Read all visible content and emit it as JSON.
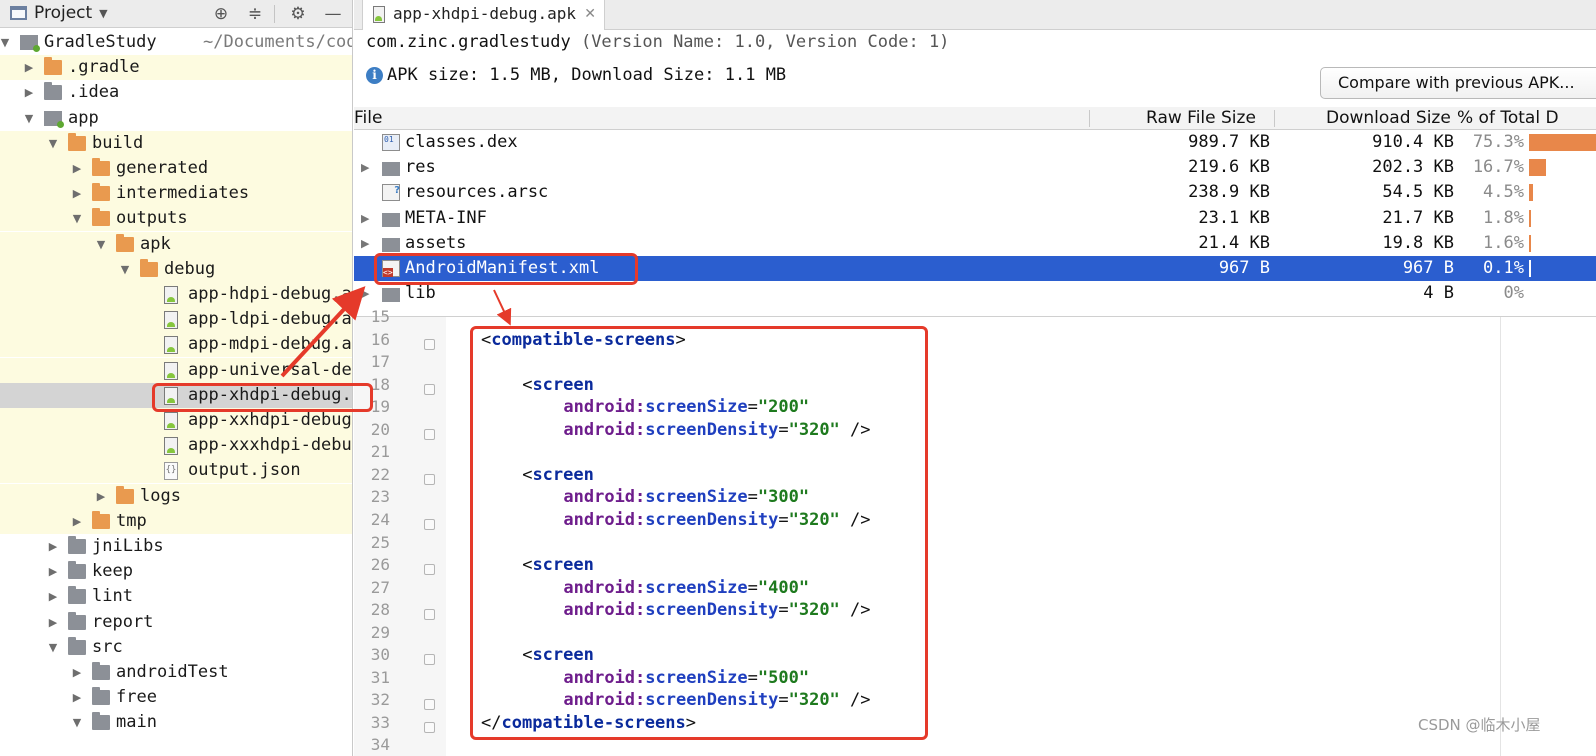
{
  "project_panel": {
    "title": "Project",
    "tree": [
      {
        "label": "GradleStudy",
        "sub": "~/Documents/code",
        "icon": "module-icon"
      },
      {
        "label": ".gradle",
        "icon": "folder-icon"
      },
      {
        "label": ".idea",
        "icon": "folder-icon"
      },
      {
        "label": "app",
        "icon": "module-icon"
      },
      {
        "label": "build",
        "icon": "folder-icon"
      },
      {
        "label": "generated",
        "icon": "folder-icon"
      },
      {
        "label": "intermediates",
        "icon": "folder-icon"
      },
      {
        "label": "outputs",
        "icon": "folder-icon"
      },
      {
        "label": "apk",
        "icon": "folder-icon"
      },
      {
        "label": "debug",
        "icon": "folder-icon"
      },
      {
        "label": "app-hdpi-debug.a",
        "icon": "apk-file-icon"
      },
      {
        "label": "app-ldpi-debug.a",
        "icon": "apk-file-icon"
      },
      {
        "label": "app-mdpi-debug.a",
        "icon": "apk-file-icon"
      },
      {
        "label": "app-universal-de",
        "icon": "apk-file-icon"
      },
      {
        "label": "app-xhdpi-debug.",
        "icon": "apk-file-icon"
      },
      {
        "label": "app-xxhdpi-debug",
        "icon": "apk-file-icon"
      },
      {
        "label": "app-xxxhdpi-debu",
        "icon": "apk-file-icon"
      },
      {
        "label": "output.json",
        "icon": "json-file-icon"
      },
      {
        "label": "logs",
        "icon": "folder-icon"
      },
      {
        "label": "tmp",
        "icon": "folder-icon"
      },
      {
        "label": "jniLibs",
        "icon": "folder-icon"
      },
      {
        "label": "keep",
        "icon": "folder-icon"
      },
      {
        "label": "lint",
        "icon": "folder-icon"
      },
      {
        "label": "report",
        "icon": "folder-icon"
      },
      {
        "label": "src",
        "icon": "folder-icon"
      },
      {
        "label": "androidTest",
        "icon": "folder-icon"
      },
      {
        "label": "free",
        "icon": "folder-icon"
      },
      {
        "label": "main",
        "icon": "folder-icon"
      }
    ]
  },
  "editor": {
    "tab_label": "app-xhdpi-debug.apk",
    "package_name": "com.zinc.gradlestudy",
    "version_info": "(Version Name: 1.0, Version Code: 1)",
    "apk_size_text": "APK size: 1.5 MB, Download Size: 1.1 MB",
    "compare_button": "Compare with previous APK..."
  },
  "file_table": {
    "columns": [
      "File",
      "Raw File Size",
      "Download Size",
      "% of Total D"
    ],
    "rows": [
      {
        "name": "classes.dex",
        "raw": "989.7 KB",
        "download": "910.4 KB",
        "percent": "75.3%",
        "fraction": 0.753,
        "expandable": false,
        "icon": "dex-file-icon"
      },
      {
        "name": "res",
        "raw": "219.6 KB",
        "download": "202.3 KB",
        "percent": "16.7%",
        "fraction": 0.167,
        "expandable": true,
        "icon": "folder-icon"
      },
      {
        "name": "resources.arsc",
        "raw": "238.9 KB",
        "download": "54.5 KB",
        "percent": "4.5%",
        "fraction": 0.045,
        "expandable": false,
        "icon": "arsc-file-icon"
      },
      {
        "name": "META-INF",
        "raw": "23.1 KB",
        "download": "21.7 KB",
        "percent": "1.8%",
        "fraction": 0.018,
        "expandable": true,
        "icon": "folder-icon"
      },
      {
        "name": "assets",
        "raw": "21.4 KB",
        "download": "19.8 KB",
        "percent": "1.6%",
        "fraction": 0.016,
        "expandable": true,
        "icon": "folder-icon"
      },
      {
        "name": "AndroidManifest.xml",
        "raw": "967 B",
        "download": "967 B",
        "percent": "0.1%",
        "fraction": 0.001,
        "expandable": false,
        "icon": "xml-file-icon"
      },
      {
        "name": "lib",
        "raw": "",
        "download": "4 B",
        "percent": "0%",
        "fraction": 0,
        "expandable": true,
        "icon": "folder-icon"
      }
    ]
  },
  "code": {
    "line_numbers": [
      "15",
      "16",
      "17",
      "18",
      "19",
      "20",
      "21",
      "22",
      "23",
      "24",
      "25",
      "26",
      "27",
      "28",
      "29",
      "30",
      "31",
      "32",
      "33",
      "34"
    ],
    "open_tag": "compatible-screens",
    "screen_tag": "screen",
    "attr_ns": "android",
    "attr_size": "screenSize",
    "attr_density": "screenDensity",
    "screens": [
      {
        "size": "\"200\"",
        "density": "\"320\""
      },
      {
        "size": "\"300\"",
        "density": "\"320\""
      },
      {
        "size": "\"400\"",
        "density": "\"320\""
      },
      {
        "size": "\"500\"",
        "density": "\"320\""
      }
    ]
  },
  "watermark": "CSDN @临木小屋",
  "colors": {
    "selection": "#2b5ecf",
    "highlight_yellow": "#fdfbe0",
    "annotation_red": "#e53a2a",
    "progress_orange": "#e8874a"
  }
}
